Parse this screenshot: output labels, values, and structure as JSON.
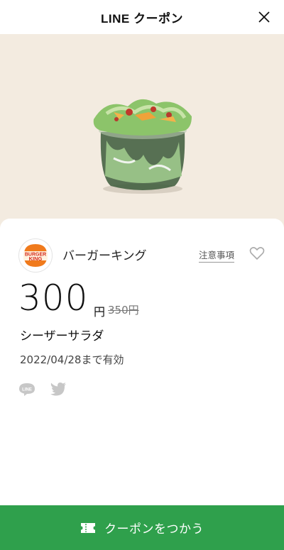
{
  "header": {
    "title": "LINE クーポン"
  },
  "coupon": {
    "brand_name": "バーガーキング",
    "logo_text_1": "BURGER",
    "logo_text_2": "KING",
    "notes_link": "注意事項",
    "price": "300",
    "price_unit": "円",
    "original_price": "350円",
    "item_name": "シーザーサラダ",
    "expiry": "2022/04/28まで有効"
  },
  "share": {
    "line_label": "LINE"
  },
  "cta": {
    "label": "クーポンをつかう"
  },
  "colors": {
    "hero_bg": "#f3ebe0",
    "cta_bg": "#2fa04c",
    "logo_orange": "#f07a1c",
    "logo_red": "#d52a1a"
  },
  "icons": [
    "close-icon",
    "heart-icon",
    "line-share-icon",
    "twitter-icon",
    "coupon-ticket-icon"
  ]
}
